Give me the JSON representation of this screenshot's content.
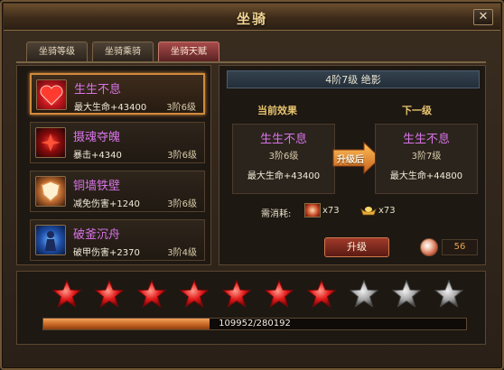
{
  "window": {
    "title": "坐骑",
    "close_symbol": "✕"
  },
  "tabs": [
    {
      "label": "坐骑等级",
      "active": false
    },
    {
      "label": "坐骑乘骑",
      "active": false
    },
    {
      "label": "坐骑天赋",
      "active": true
    }
  ],
  "skills": [
    {
      "name": "生生不息",
      "attr": "最大生命+43400",
      "level": "3阶6级",
      "icon": "heart-icon",
      "selected": true
    },
    {
      "name": "摄魂夺魄",
      "attr": "暴击+4340",
      "level": "3阶6级",
      "icon": "soul-icon",
      "selected": false
    },
    {
      "name": "铜墙铁壁",
      "attr": "减免伤害+1240",
      "level": "3阶6级",
      "icon": "shield-icon",
      "selected": false
    },
    {
      "name": "破釜沉舟",
      "attr": "破甲伤害+2370",
      "level": "3阶4级",
      "icon": "warrior-icon",
      "selected": false
    }
  ],
  "detail": {
    "stage_header": "4阶7级  绝影",
    "current_label": "当前效果",
    "next_label": "下一级",
    "current": {
      "name": "生生不息",
      "level": "3阶6级",
      "attr": "最大生命+43400"
    },
    "next": {
      "name": "生生不息",
      "level": "3阶7级",
      "attr": "最大生命+44800"
    },
    "arrow_label": "升级后",
    "consume_label": "需消耗:",
    "costs": [
      {
        "icon": "consumable-item-icon",
        "count": "x73"
      },
      {
        "icon": "gold-ingot-icon",
        "count": "x73"
      }
    ],
    "upgrade_label": "升级",
    "gem_count": "56"
  },
  "stars": {
    "filled": 7,
    "total": 10
  },
  "progress": {
    "current": 109952,
    "max": 280192,
    "text": "109952/280192"
  },
  "colors": {
    "skill_name": "#d773e6",
    "accent_gold": "#e6c36d",
    "star_red": "#e21a1a",
    "star_grey": "#a8a8a8"
  }
}
